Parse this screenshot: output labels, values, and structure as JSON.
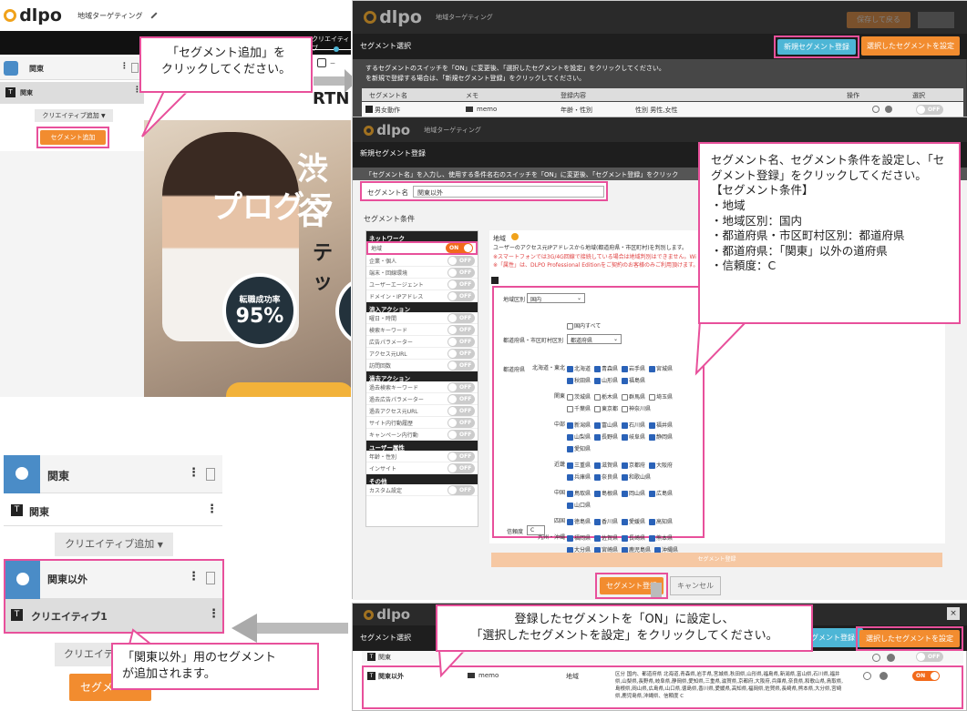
{
  "app": {
    "logo": "dlpo",
    "page_title": "地域ターゲティング"
  },
  "top_left": {
    "creative_progress": "クリエイティブ",
    "segment_row_label": "関東",
    "creative_row_label": "関東",
    "creative_add_label": "クリエイティブ追加",
    "segment_add_label": "セグメント追加"
  },
  "hero": {
    "line1": "渋谷",
    "line2": "プログラ",
    "line3": "テッ",
    "partner": "RTNE",
    "stat_label": "転職成功率",
    "stat_value": "95%"
  },
  "bottom_left": {
    "seg1_label": "関東",
    "creative1_label": "関東",
    "creative_add_label": "クリエイティブ追加",
    "seg2_label": "関東以外",
    "creative2_label": "クリエイティブ1",
    "creative_add2_label": "クリエイティ",
    "segment_add_label": "セグメ"
  },
  "callouts": {
    "add_segment": "「セグメント追加」を\nクリックしてください。",
    "register": "セグメント名、セグメント条件を設定し、「セグメント登録」をクリックしてください。\n【セグメント条件】\n・地域\n・地域区別：国内\n・都道府県・市区町村区別：都道府県\n・都道府県：「関東」以外の道府県\n・信頼度：C",
    "set_on": "登録したセグメントを「ON」に設定し、\n「選択したセグメントを設定」をクリックしてください。",
    "added": "「関東以外」用のセグメント\nが追加されます。"
  },
  "seg_select": {
    "title": "セグメント選択",
    "new_button": "新規セグメント登録",
    "set_button": "選択したセグメントを設定",
    "save_button": "保存して戻る",
    "close": "×",
    "instruction1": "するセグメントのスイッチを「ON」に変更後、「選択したセグメントを設定」をクリックしてください。",
    "instruction2": "を新規で登録する場合は、「新規セグメント登録」をクリックしてください。",
    "columns": [
      "セグメント名",
      "メモ",
      "登録内容",
      "操作",
      "選択"
    ],
    "row": {
      "name": "男女動作",
      "memo": "memo",
      "type": "年齢・性別",
      "content": "性別 男性,女性",
      "toggle": "OFF"
    }
  },
  "new_seg": {
    "title": "新規セグメント登録",
    "instruction": "「セグメント名」を入力し、使用する条件名右のスイッチを「ON」に変更後、「セグメント登録」をクリック",
    "name_label": "セグメント名",
    "name_value": "関東以外",
    "conditions_label": "セグメント条件",
    "groups": [
      {
        "head": "ネットワーク",
        "items": [
          {
            "label": "地域",
            "state": "ON"
          },
          {
            "label": "企業・個人",
            "state": "OFF"
          },
          {
            "label": "端末・回線環境",
            "state": "OFF"
          },
          {
            "label": "ユーザーエージェント",
            "state": "OFF"
          },
          {
            "label": "ドメイン・IPアドレス",
            "state": "OFF"
          }
        ]
      },
      {
        "head": "流入アクション",
        "items": [
          {
            "label": "曜日・時間",
            "state": "OFF"
          },
          {
            "label": "検索キーワード",
            "state": "OFF"
          },
          {
            "label": "広告パラメーター",
            "state": "OFF"
          },
          {
            "label": "アクセス元URL",
            "state": "OFF"
          },
          {
            "label": "訪問回数",
            "state": "OFF"
          }
        ]
      },
      {
        "head": "過去アクション",
        "items": [
          {
            "label": "過去検索キーワード",
            "state": "OFF"
          },
          {
            "label": "過去広告パラメーター",
            "state": "OFF"
          },
          {
            "label": "過去アクセス元URL",
            "state": "OFF"
          },
          {
            "label": "サイト内行動履歴",
            "state": "OFF"
          },
          {
            "label": "キャンペーン内行動",
            "state": "OFF"
          }
        ]
      },
      {
        "head": "ユーザー属性",
        "items": [
          {
            "label": "年齢・性別",
            "state": "OFF"
          },
          {
            "label": "インサイト",
            "state": "OFF"
          }
        ]
      },
      {
        "head": "その他",
        "items": [
          {
            "label": "カスタム設定",
            "state": "OFF"
          }
        ]
      }
    ],
    "region_title": "地域",
    "region_desc1": "ユーザーのアクセス元IPアドレスから地域(都道府県・市区町村)を判別します。",
    "region_desc2": "※スマートフォンでは3G/4G回線で接続している場合は地域判別はできません。Wi",
    "region_desc3": "※「属性」は、DLPO Professional Editionをご契約のお客様のみご利用頂けます。",
    "area_label": "地域区別",
    "area_value": "国内",
    "all_label": "国内すべて",
    "pref_type_label": "都道府県・市区町村区別",
    "pref_type_value": "都道府県",
    "pref_label": "都道府県",
    "regions": [
      {
        "name": "北海道・東北",
        "prefs": [
          {
            "n": "北海道",
            "c": true
          },
          {
            "n": "青森県",
            "c": true
          },
          {
            "n": "岩手県",
            "c": true
          },
          {
            "n": "宮城県",
            "c": true
          },
          {
            "n": "秋田県",
            "c": true
          },
          {
            "n": "山形県",
            "c": true
          },
          {
            "n": "福島県",
            "c": true
          }
        ]
      },
      {
        "name": "関東",
        "prefs": [
          {
            "n": "茨城県",
            "c": false
          },
          {
            "n": "栃木県",
            "c": false
          },
          {
            "n": "群馬県",
            "c": false
          },
          {
            "n": "埼玉県",
            "c": false
          },
          {
            "n": "千葉県",
            "c": false
          },
          {
            "n": "東京都",
            "c": false
          },
          {
            "n": "神奈川県",
            "c": false
          }
        ]
      },
      {
        "name": "中部",
        "prefs": [
          {
            "n": "新潟県",
            "c": true
          },
          {
            "n": "富山県",
            "c": true
          },
          {
            "n": "石川県",
            "c": true
          },
          {
            "n": "福井県",
            "c": true
          },
          {
            "n": "山梨県",
            "c": true
          },
          {
            "n": "長野県",
            "c": true
          },
          {
            "n": "岐阜県",
            "c": true
          },
          {
            "n": "静岡県",
            "c": true
          },
          {
            "n": "愛知県",
            "c": true
          }
        ]
      },
      {
        "name": "近畿",
        "prefs": [
          {
            "n": "三重県",
            "c": true
          },
          {
            "n": "滋賀県",
            "c": true
          },
          {
            "n": "京都府",
            "c": true
          },
          {
            "n": "大阪府",
            "c": true
          },
          {
            "n": "兵庫県",
            "c": true
          },
          {
            "n": "奈良県",
            "c": true
          },
          {
            "n": "和歌山県",
            "c": true
          }
        ]
      },
      {
        "name": "中国",
        "prefs": [
          {
            "n": "鳥取県",
            "c": true
          },
          {
            "n": "島根県",
            "c": true
          },
          {
            "n": "岡山県",
            "c": true
          },
          {
            "n": "広島県",
            "c": true
          },
          {
            "n": "山口県",
            "c": true
          }
        ]
      },
      {
        "name": "四国",
        "prefs": [
          {
            "n": "徳島県",
            "c": true
          },
          {
            "n": "香川県",
            "c": true
          },
          {
            "n": "愛媛県",
            "c": true
          },
          {
            "n": "高知県",
            "c": true
          }
        ]
      },
      {
        "name": "九州・沖縄",
        "prefs": [
          {
            "n": "福岡県",
            "c": true
          },
          {
            "n": "佐賀県",
            "c": true
          },
          {
            "n": "長崎県",
            "c": true
          },
          {
            "n": "熊本県",
            "c": true
          },
          {
            "n": "大分県",
            "c": true
          },
          {
            "n": "宮崎県",
            "c": true
          },
          {
            "n": "鹿児島県",
            "c": true
          },
          {
            "n": "沖縄県",
            "c": true
          }
        ]
      }
    ],
    "reliability_label": "信頼度",
    "reliability_value": "C",
    "inner_register": "セグメント登録",
    "register_button": "セグメント登録",
    "cancel_button": "キャンセル"
  },
  "seg_select_bottom": {
    "title": "セグメント選択",
    "new_button": "新規セグメント登録",
    "set_button": "選択したセグメントを設定",
    "row1_name": "関東",
    "row2_name": "関東以外",
    "row2_memo": "memo",
    "row2_type": "地域",
    "row2_content": "区分 国内、都道府県 北海道,青森県,岩手県,宮城県,秋田県,山形県,福島県,新潟県,富山県,石川県,福井県,山梨県,長野県,岐阜県,静岡県,愛知県,三重県,滋賀県,京都府,大阪府,兵庫県,奈良県,和歌山県,鳥取県,島根県,岡山県,広島県,山口県,徳島県,香川県,愛媛県,高知県,福岡県,佐賀県,長崎県,熊本県,大分県,宮崎県,鹿児島県,沖縄県、信頼度 C",
    "row1_toggle": "OFF",
    "row2_toggle": "ON"
  }
}
